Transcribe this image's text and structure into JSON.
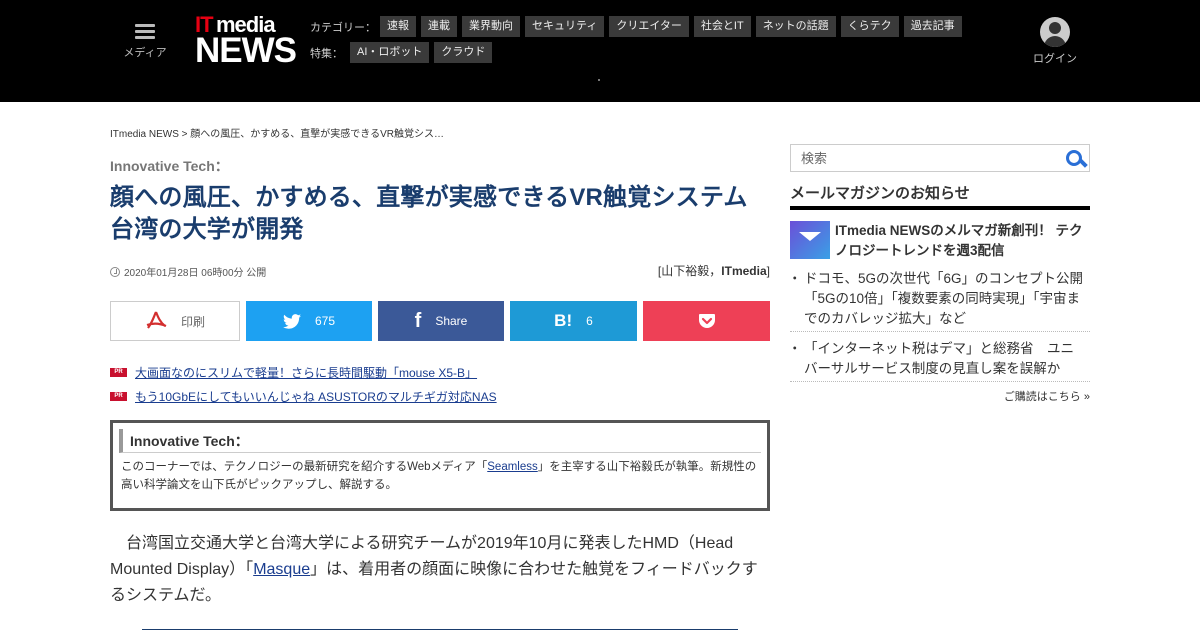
{
  "header": {
    "menu_label": "メディア",
    "logo_it": "IT",
    "logo_media": "media",
    "logo_news": "NEWS",
    "category_label": "カテゴリー：",
    "categories": [
      "速報",
      "連載",
      "業界動向",
      "セキュリティ",
      "クリエイター",
      "社会とIT",
      "ネットの話題",
      "くらテク",
      "過去記事"
    ],
    "feature_label": "特集：",
    "features": [
      "AI・ロボット",
      "クラウド"
    ],
    "login_label": "ログイン"
  },
  "article": {
    "breadcrumb": "ITmedia NEWS > 顔への風圧、かすめる、直撃が実感できるVR触覚シス…",
    "series": "Innovative Tech：",
    "title": "顔への風圧、かすめる、直撃が実感できるVR触覚システム　台湾の大学が開発",
    "date": "2020年01月28日 06時00分 公開",
    "author_open": "[",
    "author_name": "山下裕毅",
    "author_sep": "，",
    "author_org": "ITmedia",
    "author_close": "]",
    "share": {
      "print_label": "印刷",
      "twitter_count": "675",
      "facebook_label": "Share",
      "hatena_icon": "B!",
      "hatena_count": "6"
    },
    "pr_badge": "PR",
    "pr_links": [
      "大画面なのにスリムで軽量！さらに長時間駆動「mouse X5-B」",
      "もう10GbEにしてもいいんじゃね ASUSTORのマルチギガ対応NAS"
    ],
    "corner": {
      "heading": "Innovative Tech：",
      "text_before": "このコーナーでは、テクノロジーの最新研究を紹介するWebメディア「",
      "link": "Seamless",
      "text_after": "」を主宰する山下裕毅氏が執筆。新規性の高い科学論文を山下氏がピックアップし、解説する。"
    },
    "body_before": "台湾国立交通大学と台湾大学による研究チームが2019年10月に発表したHMD（Head Mounted Display）「",
    "body_link": "Masque",
    "body_after": "」は、着用者の顔面に映像に合わせた触覚をフィードバックするシステムだ。"
  },
  "sidebar": {
    "search_placeholder": "検索",
    "mail_heading": "メールマガジンのお知らせ",
    "feature_text": "ITmedia NEWSのメルマガ新創刊！ テクノロジートレンドを週3配信",
    "news": [
      "ドコモ、5Gの次世代「6G」のコンセプト公開　「5Gの10倍」「複数要素の同時実現」「宇宙までのカバレッジ拡大」など",
      "「インターネット税はデマ」と総務省　ユニバーサルサービス制度の見直し案を誤解か"
    ],
    "subscribe": "ご購読はこちら »"
  },
  "colors": {
    "header_bg": "#000000",
    "title": "#1a3d6d",
    "twitter": "#1da1f2",
    "facebook": "#3b5998",
    "hatena": "#1e9ad6",
    "pocket": "#ee4056",
    "pr_badge": "#c8102e"
  }
}
